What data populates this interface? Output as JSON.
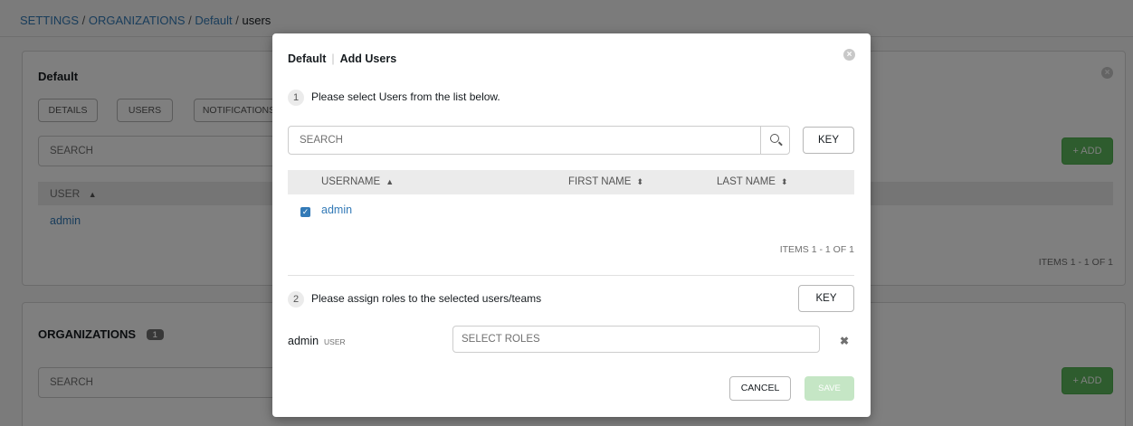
{
  "breadcrumb": {
    "items": [
      "SETTINGS",
      "ORGANIZATIONS",
      "Default"
    ],
    "separator": "/",
    "current": "users"
  },
  "org_panel": {
    "title": "Default",
    "tabs": [
      "DETAILS",
      "USERS",
      "NOTIFICATIONS"
    ],
    "search_placeholder": "SEARCH",
    "add_label": "+ ADD",
    "column_header": "USER",
    "rows": [
      "admin"
    ],
    "items_label": "ITEMS  1 - 1 OF 1"
  },
  "organizations_panel": {
    "title": "ORGANIZATIONS",
    "count": "1",
    "search_placeholder": "SEARCH",
    "add_label": "+ ADD"
  },
  "modal": {
    "header_org": "Default",
    "header_separator": "|",
    "header_title": "Add Users",
    "step1": {
      "number": "1",
      "text": "Please select Users from the list below."
    },
    "search_placeholder": "SEARCH",
    "key_label": "KEY",
    "columns": [
      "USERNAME",
      "FIRST NAME",
      "LAST NAME"
    ],
    "rows": [
      {
        "username": "admin",
        "checked": true
      }
    ],
    "items_label": "ITEMS  1 - 1 OF 1",
    "step2": {
      "number": "2",
      "text": "Please assign roles to the selected users/teams"
    },
    "key2_label": "KEY",
    "role_assignment": {
      "name": "admin",
      "type": "USER",
      "placeholder": "SELECT ROLES"
    },
    "cancel_label": "CANCEL",
    "save_label": "SAVE"
  },
  "icons": {
    "close": "close-icon",
    "search": "search-icon",
    "sort_asc": "sort-asc-icon",
    "sort_both": "sort-icon",
    "remove": "remove-icon",
    "checkbox": "checkbox-checked-icon"
  },
  "colors": {
    "link": "#337ab7",
    "add_button": "#5cb85c",
    "save_disabled": "#c5e6c5",
    "overlay": "rgba(0,0,0,0.5)"
  }
}
